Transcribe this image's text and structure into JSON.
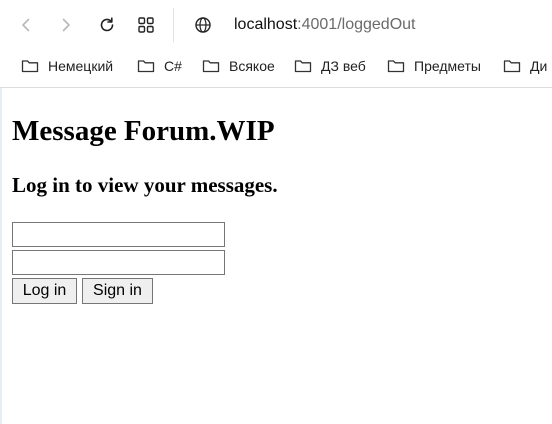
{
  "browser": {
    "address": {
      "host": "localhost",
      "rest": ":4001/loggedOut"
    },
    "bookmarks": [
      {
        "label": "Немецкий",
        "icon": "folder-icon"
      },
      {
        "label": "C#",
        "icon": "folder-icon"
      },
      {
        "label": "Всякое",
        "icon": "folder-icon"
      },
      {
        "label": "ДЗ веб",
        "icon": "folder-icon"
      },
      {
        "label": "Предметы",
        "icon": "folder-icon"
      },
      {
        "label": "Ди",
        "icon": "folder-icon"
      }
    ],
    "icons": {
      "back": "back-arrow-icon",
      "forward": "forward-arrow-icon",
      "reload": "reload-icon",
      "tabs": "tab-grid-icon",
      "site_info": "globe-icon"
    }
  },
  "page": {
    "title": "Message Forum.WIP",
    "subtitle": "Log in to view your messages.",
    "login_form": {
      "username_value": "",
      "password_value": "",
      "login_label": "Log in",
      "signin_label": "Sign in"
    }
  },
  "colors": {
    "button_bg": "#efefef",
    "border": "#767676",
    "muted_text": "#6b6b6b"
  }
}
